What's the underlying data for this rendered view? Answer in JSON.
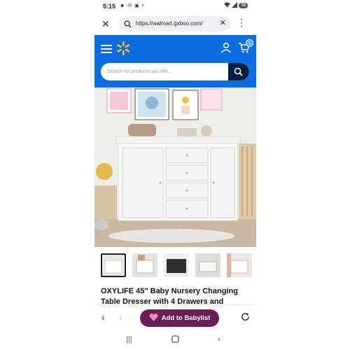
{
  "status_bar": {
    "time": "5:15",
    "battery": "70"
  },
  "browser": {
    "url": "https://walmart.gxboo.com/"
  },
  "header": {
    "cart_count": "1",
    "search_placeholder": "Search for products you like...",
    "brand_color": "#0b6de0",
    "search_button_color": "#041f41"
  },
  "product": {
    "title": "OXYLIFE 45\" Baby Nursery Changing Table Dresser with 4 Drawers and",
    "thumbnail_count": 5,
    "selected_thumbnail": 1
  },
  "actions": {
    "babylist_label": "Add to Babylist",
    "babylist_color": "#6a1e57"
  },
  "icons": [
    "close-icon",
    "search-icon",
    "clear-icon",
    "more-vert-icon",
    "menu-icon",
    "walmart-spark-icon",
    "account-icon",
    "cart-icon",
    "back-icon",
    "forward-icon",
    "heart-icon",
    "reload-icon",
    "recents-icon",
    "home-icon",
    "nav-back-icon"
  ]
}
